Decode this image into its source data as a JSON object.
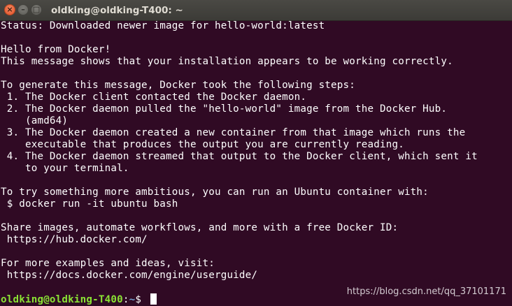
{
  "window": {
    "title": "oldking@oldking-T400: ~",
    "close_glyph": "×",
    "minimize_glyph": "–",
    "maximize_glyph": "□"
  },
  "terminal": {
    "lines": [
      "Status: Downloaded newer image for hello-world:latest",
      "",
      "Hello from Docker!",
      "This message shows that your installation appears to be working correctly.",
      "",
      "To generate this message, Docker took the following steps:",
      " 1. The Docker client contacted the Docker daemon.",
      " 2. The Docker daemon pulled the \"hello-world\" image from the Docker Hub.",
      "    (amd64)",
      " 3. The Docker daemon created a new container from that image which runs the",
      "    executable that produces the output you are currently reading.",
      " 4. The Docker daemon streamed that output to the Docker client, which sent it",
      "    to your terminal.",
      "",
      "To try something more ambitious, you can run an Ubuntu container with:",
      " $ docker run -it ubuntu bash",
      "",
      "Share images, automate workflows, and more with a free Docker ID:",
      " https://hub.docker.com/",
      "",
      "For more examples and ideas, visit:",
      " https://docs.docker.com/engine/userguide/",
      ""
    ],
    "prompt": {
      "user_host": "oldking@oldking-T400",
      "separator": ":",
      "path": "~",
      "symbol": "$ "
    }
  },
  "watermark": "https://blog.csdn.net/qq_37101171",
  "colors": {
    "background": "#300a24",
    "text": "#ffffff",
    "prompt_user": "#8ae234",
    "prompt_path": "#729fcf"
  }
}
